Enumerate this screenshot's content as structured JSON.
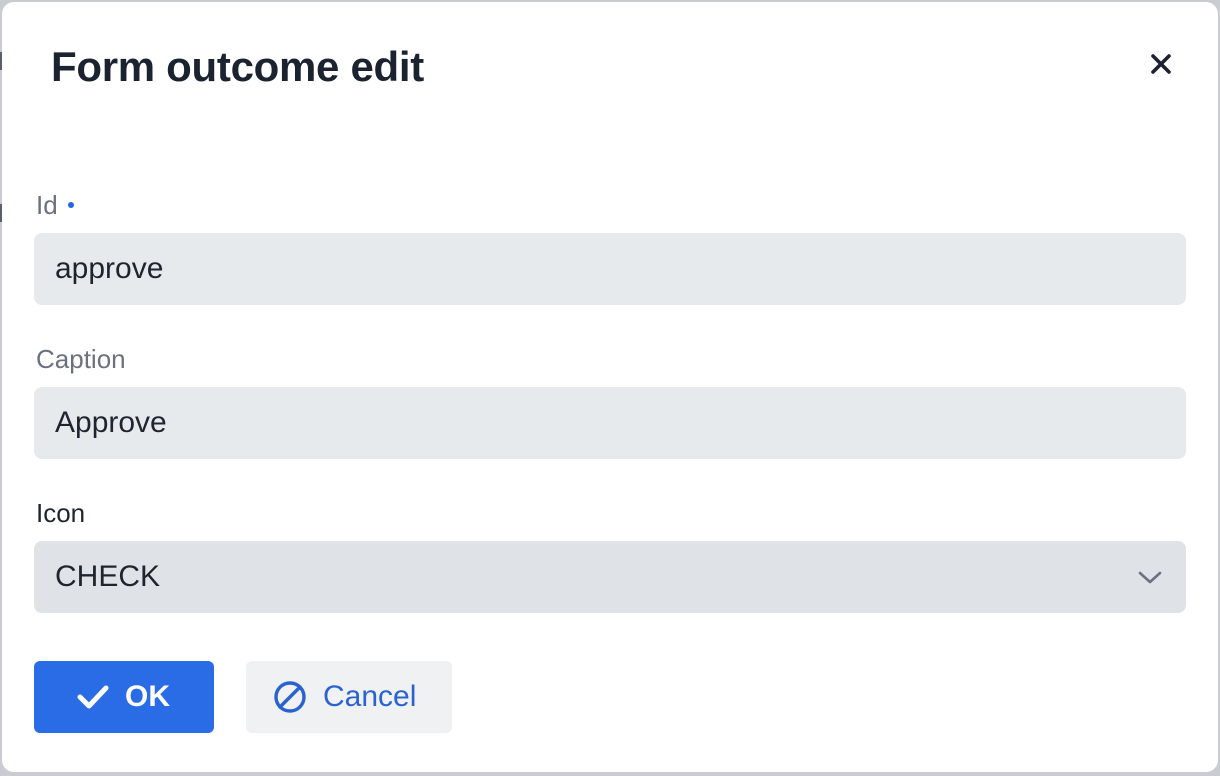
{
  "dialog": {
    "title": "Form outcome edit"
  },
  "fields": {
    "id": {
      "label": "Id",
      "value": "approve",
      "required": true
    },
    "caption": {
      "label": "Caption",
      "value": "Approve"
    },
    "icon": {
      "label": "Icon",
      "value": "CHECK"
    }
  },
  "buttons": {
    "ok": {
      "label": "OK",
      "icon": "check-icon"
    },
    "cancel": {
      "label": "Cancel",
      "icon": "ban-icon"
    }
  },
  "icons": {
    "close": "close-icon",
    "dropdown": "chevron-down-icon"
  },
  "colors": {
    "primary": "#2a6ce6",
    "cancel_text": "#2a63d0",
    "input_bg": "#e7eaed",
    "required_dot": "#2563eb"
  }
}
